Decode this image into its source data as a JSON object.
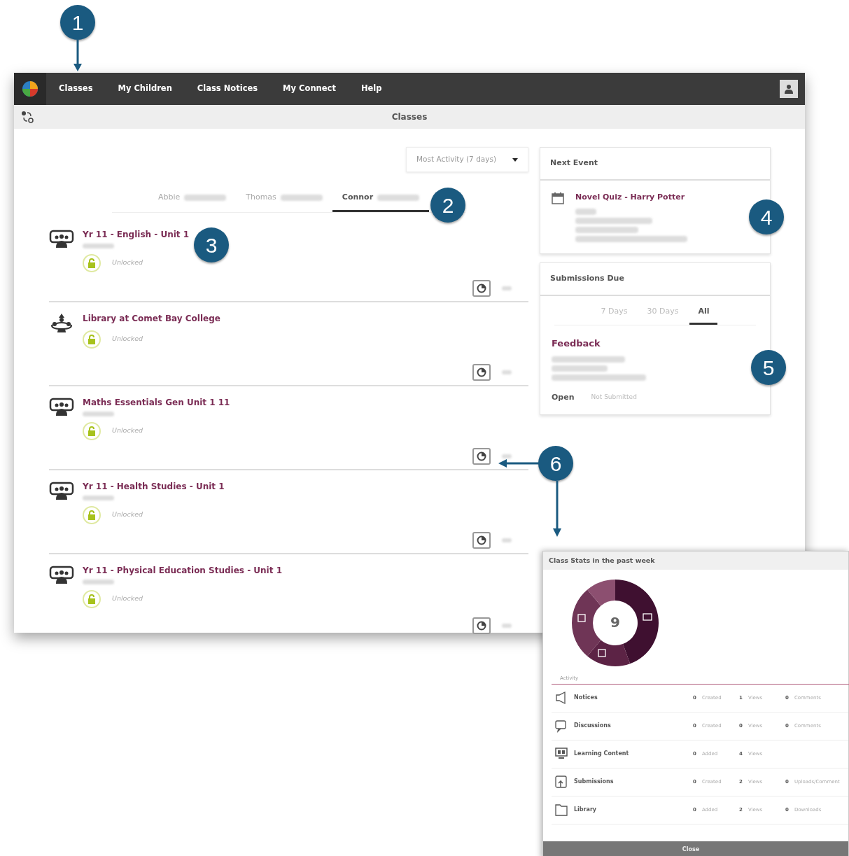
{
  "nav": {
    "items": [
      {
        "label": "Classes"
      },
      {
        "label": "My Children"
      },
      {
        "label": "Class Notices"
      },
      {
        "label": "My Connect"
      },
      {
        "label": "Help"
      }
    ]
  },
  "subheader": {
    "title": "Classes"
  },
  "sort": {
    "value": "Most Activity (7 days)"
  },
  "children_tabs": [
    {
      "label": "Abbie",
      "selected": false
    },
    {
      "label": "Thomas",
      "selected": false
    },
    {
      "label": "Connor",
      "selected": true
    }
  ],
  "classes": [
    {
      "kind": "class",
      "name": "Yr 11 - English - Unit 1",
      "code": true,
      "status": "Unlocked"
    },
    {
      "kind": "library",
      "name": "Library at Comet Bay College",
      "code": false,
      "status": "Unlocked"
    },
    {
      "kind": "class",
      "name": "Maths Essentials Gen Unit 1 11",
      "code": true,
      "status": "Unlocked"
    },
    {
      "kind": "class",
      "name": "Yr 11 - Health Studies - Unit 1",
      "code": true,
      "status": "Unlocked"
    },
    {
      "kind": "class",
      "name": "Yr 11 - Physical Education Studies - Unit 1",
      "code": true,
      "status": "Unlocked"
    }
  ],
  "next_event": {
    "title": "Next Event",
    "event": "Novel Quiz - Harry Potter"
  },
  "submissions": {
    "title": "Submissions Due",
    "tabs": [
      {
        "label": "7 Days",
        "selected": false
      },
      {
        "label": "30 Days",
        "selected": false
      },
      {
        "label": "All",
        "selected": true
      }
    ],
    "heading": "Feedback",
    "open_label": "Open",
    "state": "Not Submitted"
  },
  "stats": {
    "title": "Class Stats in the past week",
    "total": "9",
    "activity_label": "Activity",
    "rows": [
      {
        "kind": "notices",
        "name": "Notices",
        "figures": [
          {
            "value": "0",
            "label": "Created"
          },
          {
            "value": "1",
            "label": "Views"
          },
          {
            "value": "0",
            "label": "Comments"
          }
        ]
      },
      {
        "kind": "discussions",
        "name": "Discussions",
        "figures": [
          {
            "value": "0",
            "label": "Created"
          },
          {
            "value": "0",
            "label": "Views"
          },
          {
            "value": "0",
            "label": "Comments"
          }
        ]
      },
      {
        "kind": "content",
        "name": "Learning Content",
        "figures": [
          {
            "value": "0",
            "label": "Added"
          },
          {
            "value": "4",
            "label": "Views"
          }
        ]
      },
      {
        "kind": "submissions",
        "name": "Submissions",
        "figures": [
          {
            "value": "0",
            "label": "Created"
          },
          {
            "value": "2",
            "label": "Views"
          },
          {
            "value": "0",
            "label": "Uploads/Comment"
          }
        ]
      },
      {
        "kind": "library",
        "name": "Library",
        "figures": [
          {
            "value": "0",
            "label": "Added"
          },
          {
            "value": "2",
            "label": "Views"
          },
          {
            "value": "0",
            "label": "Downloads"
          }
        ]
      }
    ],
    "close": "Close"
  },
  "callouts": [
    "1",
    "2",
    "3",
    "4",
    "5",
    "6"
  ]
}
